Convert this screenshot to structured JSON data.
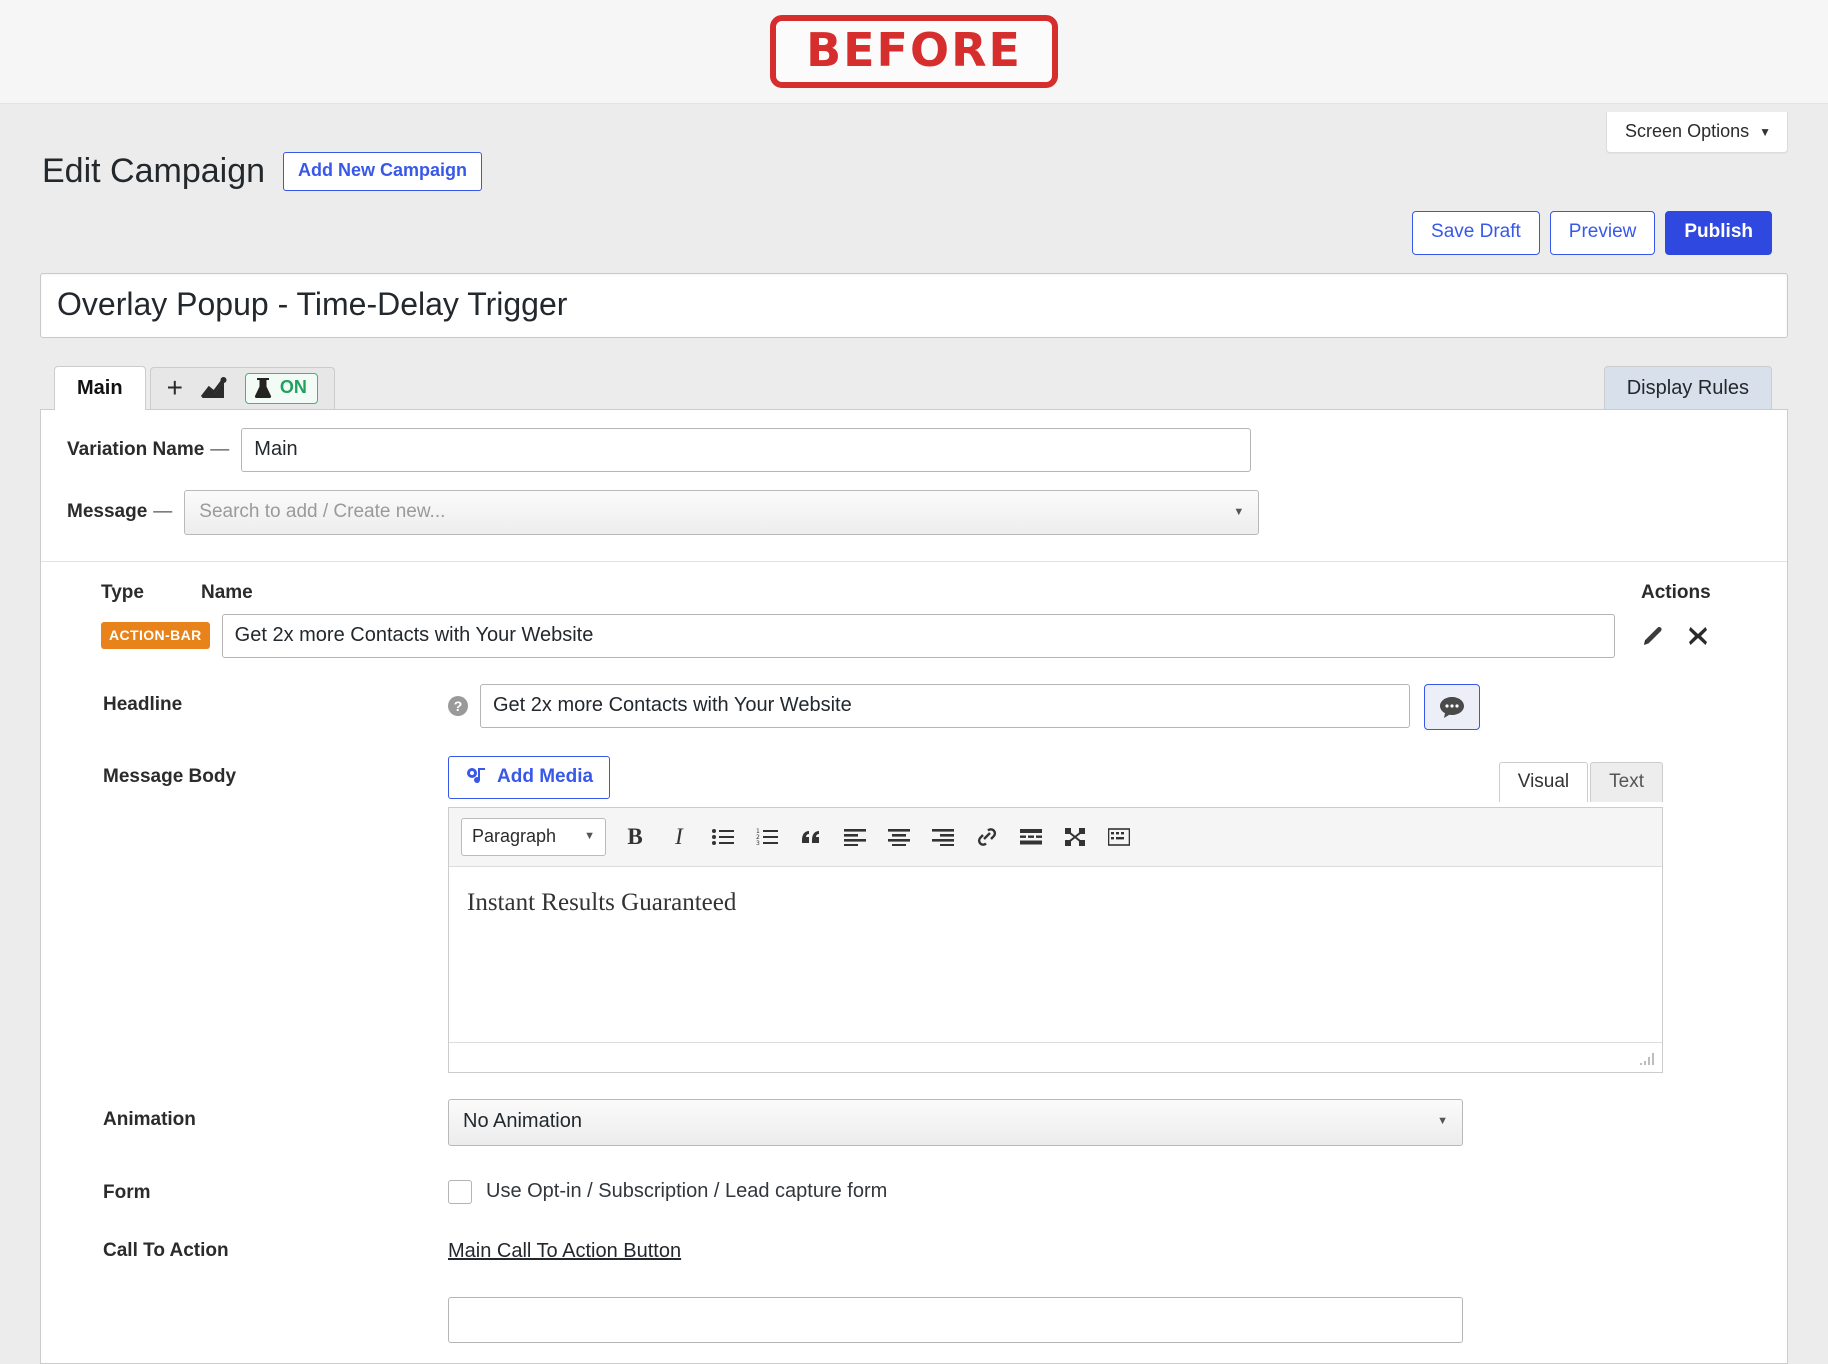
{
  "stamp": {
    "label": "BEFORE"
  },
  "header": {
    "screen_options": "Screen Options",
    "page_title": "Edit Campaign",
    "add_new_label": "Add New Campaign",
    "save_draft_label": "Save Draft",
    "preview_label": "Preview",
    "publish_label": "Publish",
    "campaign_title_value": "Overlay Popup - Time-Delay Trigger"
  },
  "tabs": {
    "main_label": "Main",
    "plus_label": "+",
    "ab_state": "ON",
    "display_rules_label": "Display Rules"
  },
  "form": {
    "variation_name_label": "Variation Name",
    "dash": "—",
    "variation_name_value": "Main",
    "message_label": "Message",
    "message_placeholder": "Search to add / Create new..."
  },
  "table": {
    "type_header": "Type",
    "name_header": "Name",
    "actions_header": "Actions",
    "row": {
      "type_badge": "ACTION-BAR",
      "name_value": "Get 2x more Contacts with Your Website"
    }
  },
  "headline": {
    "label": "Headline",
    "help": "?",
    "value": "Get 2x more Contacts with Your Website"
  },
  "message_body": {
    "label": "Message Body",
    "add_media_label": "Add Media",
    "visual_tab": "Visual",
    "text_tab": "Text",
    "paragraph_label": "Paragraph",
    "content": "Instant Results Guaranteed"
  },
  "animation": {
    "label": "Animation",
    "value": "No Animation"
  },
  "form_opt": {
    "label": "Form",
    "checkbox_label": "Use Opt-in / Subscription / Lead capture form",
    "checked": false
  },
  "cta": {
    "label": "Call To Action",
    "link_label": "Main Call To Action Button"
  },
  "colors": {
    "accent_blue": "#3858e9",
    "publish_blue": "#2f48e0",
    "badge_orange": "#e8821a",
    "stamp_red": "#d62d2d",
    "ab_green": "#22a05f",
    "display_rules_bg": "#d8e0ec"
  }
}
